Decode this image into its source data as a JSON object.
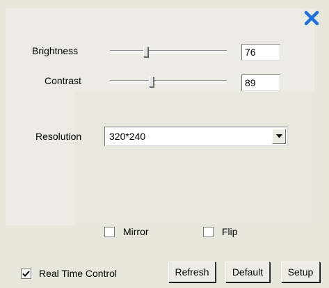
{
  "window": {
    "close_icon": "close-x-icon",
    "close_color": "#1f6fd8"
  },
  "brightness": {
    "label": "Brightness",
    "value": "76",
    "slider_fraction": 0.3
  },
  "contrast": {
    "label": "Contrast",
    "value": "89",
    "slider_fraction": 0.35
  },
  "resolution": {
    "label": "Resolution",
    "selected": "320*240"
  },
  "mirror": {
    "label": "Mirror",
    "checked": false
  },
  "flip": {
    "label": "Flip",
    "checked": false
  },
  "realtime": {
    "label": "Real Time Control",
    "checked": true
  },
  "buttons": {
    "refresh": "Refresh",
    "default": "Default",
    "setup": "Setup"
  }
}
